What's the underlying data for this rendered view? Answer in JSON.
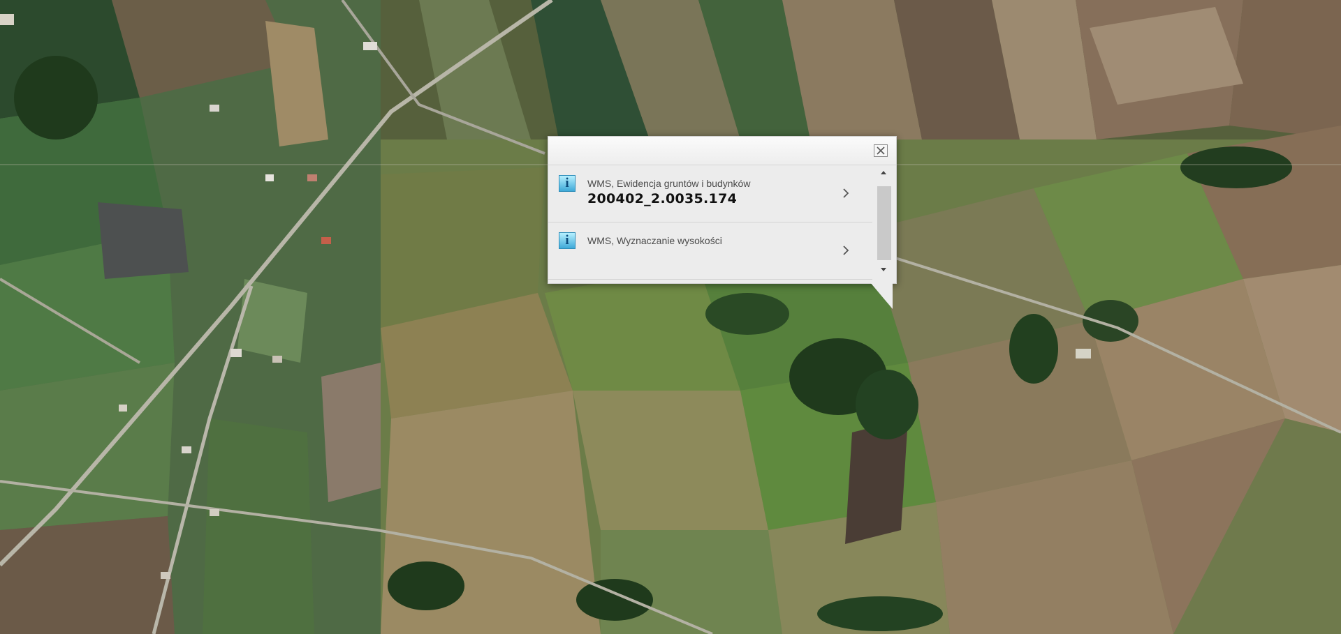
{
  "popup": {
    "results": [
      {
        "icon": "info-icon",
        "glyph": "i",
        "layer": "WMS, Ewidencja gruntów i budynków",
        "value": "200402_2.0035.174"
      },
      {
        "icon": "info-icon",
        "glyph": "i",
        "layer": "WMS, Wyznaczanie wysokości",
        "value": ""
      }
    ],
    "close_icon": "close-icon",
    "chevron_icon": "chevron-right-icon"
  },
  "map": {
    "type": "satellite-orthophoto",
    "colors": {
      "field_green": "#5d7a3c",
      "field_brown": "#8a7156",
      "road": "#b8b6a8"
    }
  }
}
